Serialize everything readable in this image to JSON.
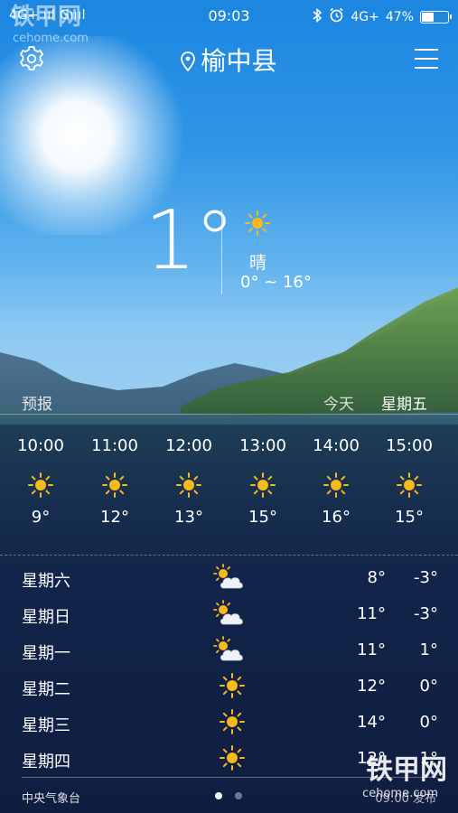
{
  "status_bar": {
    "left": "4G+ ııl Gıııl",
    "time": "09:03",
    "network": "4G+",
    "battery_text": "47%",
    "battery_level": 0.47
  },
  "watermark": {
    "brand": "铁甲网",
    "site": "cehome.com"
  },
  "header": {
    "location": "榆中县"
  },
  "current": {
    "temperature": "1°",
    "condition": "晴",
    "range": "0° ~ 16°"
  },
  "forecast_header": {
    "title": "预报",
    "today": "今天",
    "weekday": "星期五"
  },
  "hourly": [
    {
      "time": "10:00",
      "icon": "sun-icon",
      "temp": "9°"
    },
    {
      "time": "11:00",
      "icon": "sun-icon",
      "temp": "12°"
    },
    {
      "time": "12:00",
      "icon": "sun-icon",
      "temp": "13°"
    },
    {
      "time": "13:00",
      "icon": "sun-icon",
      "temp": "15°"
    },
    {
      "time": "14:00",
      "icon": "sun-icon",
      "temp": "16°"
    },
    {
      "time": "15:00",
      "icon": "sun-icon",
      "temp": "15°"
    }
  ],
  "daily": [
    {
      "day": "星期六",
      "icon": "partly-cloudy-icon",
      "high": "8°",
      "low": "-3°"
    },
    {
      "day": "星期日",
      "icon": "partly-cloudy-icon",
      "high": "11°",
      "low": "-3°"
    },
    {
      "day": "星期一",
      "icon": "partly-cloudy-icon",
      "high": "11°",
      "low": "1°"
    },
    {
      "day": "星期二",
      "icon": "sun-icon",
      "high": "12°",
      "low": "0°"
    },
    {
      "day": "星期三",
      "icon": "sun-icon",
      "high": "14°",
      "low": "0°"
    },
    {
      "day": "星期四",
      "icon": "sun-icon",
      "high": "12°",
      "low": "1°"
    }
  ],
  "footer": {
    "source": "中央气象台",
    "update_time": "09:00 发布",
    "page_count": 2,
    "active_page": 1
  },
  "colors": {
    "sun": "#f7b91c",
    "sky_top": "#1c86e0",
    "night_bottom": "#0f1d40"
  }
}
